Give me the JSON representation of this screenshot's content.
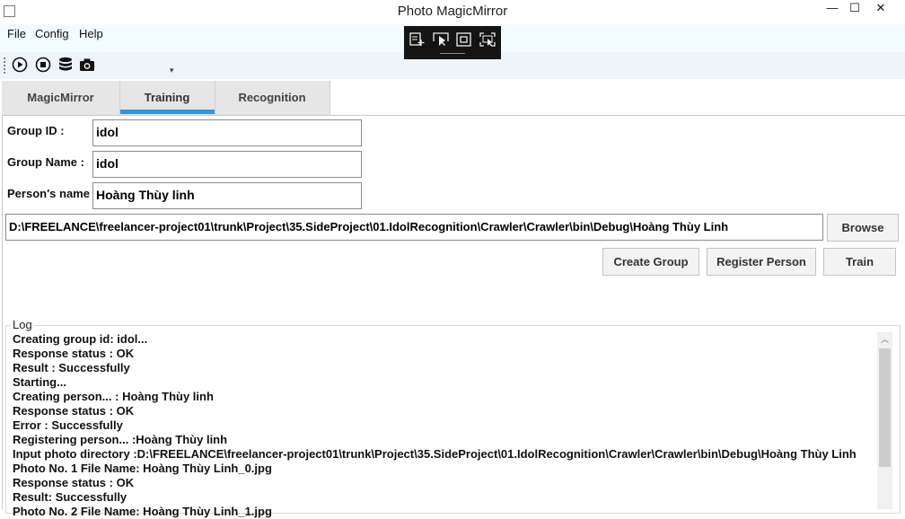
{
  "window": {
    "title": "Photo MagicMirror",
    "minimize_glyph": "—",
    "maximize_glyph": "☐",
    "close_glyph": "✕"
  },
  "menu": {
    "items": [
      "File",
      "Config",
      "Help"
    ]
  },
  "floating_toolbar": {
    "icons": [
      "add-window-icon",
      "select-pointer-icon",
      "frame-icon",
      "region-select-icon"
    ]
  },
  "toolbar": {
    "icons": [
      "play-icon",
      "stop-icon",
      "database-icon",
      "camera-icon"
    ],
    "overflow_glyph": "▾"
  },
  "tabs": [
    {
      "label": "MagicMirror",
      "active": false
    },
    {
      "label": "Training",
      "active": true
    },
    {
      "label": "Recognition",
      "active": false
    }
  ],
  "form": {
    "group_id_label": "Group ID :",
    "group_id_value": "idol",
    "group_name_label": "Group Name :",
    "group_name_value": "idol",
    "person_name_label": "Person's name :",
    "person_name_value": "Hoàng Thùy linh",
    "path_value": "D:\\FREELANCE\\freelancer-project01\\trunk\\Project\\35.SideProject\\01.IdolRecognition\\Crawler\\Crawler\\bin\\Debug\\Hoàng Thùy Linh",
    "browse_label": "Browse",
    "create_group_label": "Create Group",
    "register_person_label": "Register Person",
    "train_label": "Train"
  },
  "log": {
    "legend": "Log",
    "lines": [
      "Creating group id: idol...",
      "Response status : OK",
      "Result : Successfully",
      "Starting...",
      "Creating person...  : Hoàng Thùy linh",
      "Response status : OK",
      "Error : Successfully",
      "Registering person... :Hoàng Thùy linh",
      "Input photo directory :D:\\FREELANCE\\freelancer-project01\\trunk\\Project\\35.SideProject\\01.IdolRecognition\\Crawler\\Crawler\\bin\\Debug\\Hoàng Thùy Linh",
      "Photo No. 1 File Name: Hoàng Thùy Linh_0.jpg",
      "Response status : OK",
      "Result: Successfully",
      "Photo No. 2 File Name: Hoàng Thùy Linh_1.jpg"
    ],
    "scroll_up_glyph": "︿"
  }
}
